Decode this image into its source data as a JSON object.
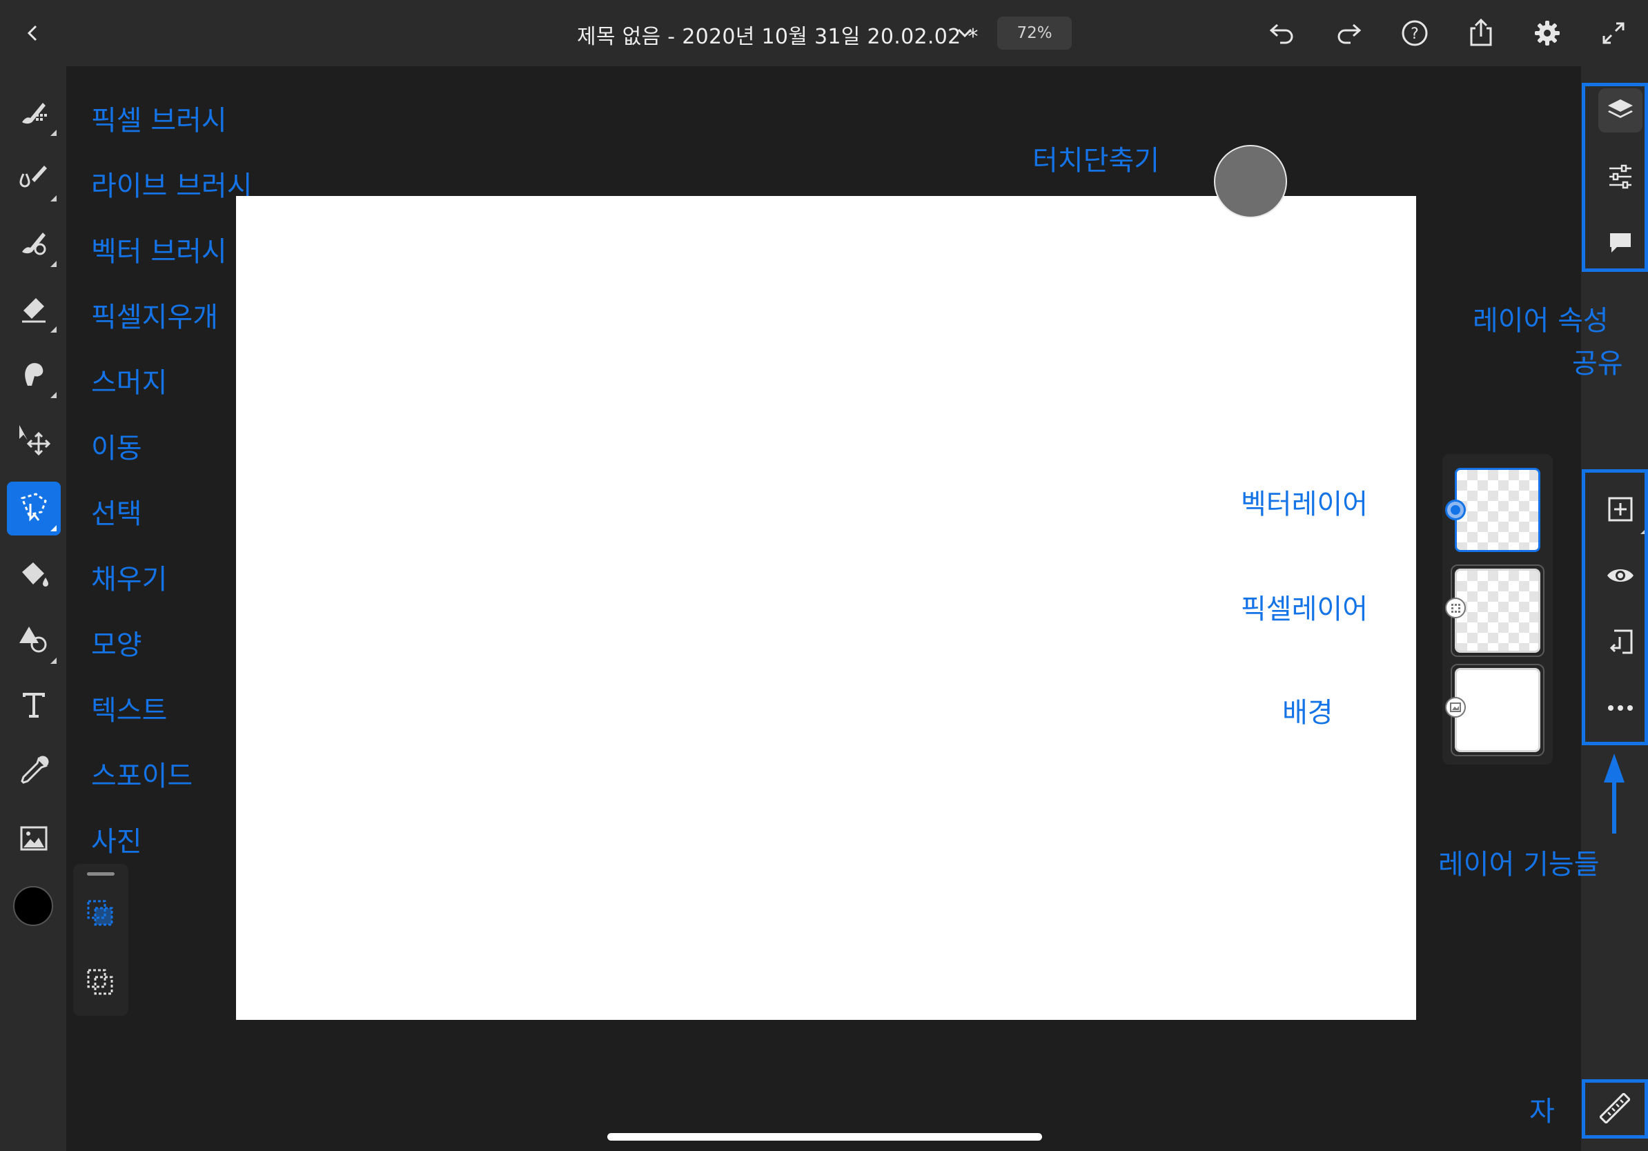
{
  "header": {
    "back": "back-icon",
    "title": "제목 없음 - 2020년 10월 31일 20.02.02 *",
    "zoom": "72%",
    "actions": [
      "undo-icon",
      "redo-icon",
      "help-icon",
      "share-icon",
      "settings-icon",
      "fullscreen-icon"
    ]
  },
  "tools": [
    {
      "icon": "pixel-brush-icon",
      "label": "픽셀 브러시"
    },
    {
      "icon": "live-brush-icon",
      "label": "라이브 브러시"
    },
    {
      "icon": "vector-brush-icon",
      "label": "벡터 브러시"
    },
    {
      "icon": "pixel-eraser-icon",
      "label": "픽셀지우개"
    },
    {
      "icon": "smudge-icon",
      "label": "스머지"
    },
    {
      "icon": "move-icon",
      "label": "이동"
    },
    {
      "icon": "select-icon",
      "label": "선택",
      "active": true
    },
    {
      "icon": "fill-icon",
      "label": "채우기"
    },
    {
      "icon": "shape-icon",
      "label": "모양"
    },
    {
      "icon": "text-icon",
      "label": "텍스트"
    },
    {
      "icon": "eyedropper-icon",
      "label": "스포이드"
    },
    {
      "icon": "photo-icon",
      "label": "사진"
    }
  ],
  "color": {
    "current": "#000000"
  },
  "annotations": {
    "touch_shortcut": "터치단축기",
    "vector_layer": "벡터레이어",
    "pixel_layer": "픽셀레이어",
    "background": "배경",
    "layer_props_share_1": "레이어 속성",
    "layer_props_share_2": "공유",
    "layer_functions": "레이어 기능들",
    "ruler": "자"
  },
  "right_panel": {
    "top_icons": [
      "layers-icon",
      "properties-icon",
      "comments-icon"
    ],
    "layer_icons": [
      "add-layer-icon",
      "visibility-icon",
      "merge-down-icon",
      "more-icon"
    ],
    "bottom_icon": "ruler-icon"
  },
  "colors": {
    "accent": "#1473e6",
    "bar": "#2b2b2c",
    "workspace": "#1e1e1e"
  }
}
